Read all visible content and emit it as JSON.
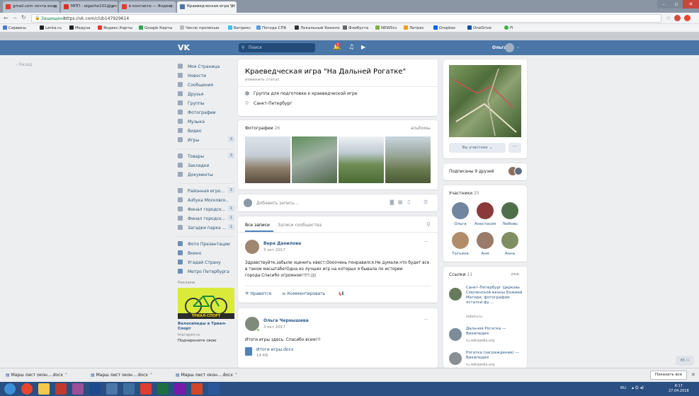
{
  "browser": {
    "tabs": [
      {
        "label": "gmail.com почта вход"
      },
      {
        "label": "МПП - olgache101@gm"
      },
      {
        "label": "в контакте — Яндекс:"
      },
      {
        "label": "Краеведческая игра \"Н"
      }
    ],
    "secure_label": "Защищено",
    "url": "https://vk.com/club147929614",
    "bookmarks": [
      "Сервисы",
      "Lenta.ru",
      "Медуза",
      "Яндекс.Карты",
      "Google Карты",
      "Число прописью",
      "Битрикс",
      "Погода СПб",
      "Локальный Кинопо",
      "Флибуста",
      "NEWSru",
      "Литрес",
      "Dropbox",
      "OneDrive",
      "Fi"
    ]
  },
  "vk": {
    "logo": "VK",
    "search_placeholder": "Поиск",
    "user_name": "Ольга",
    "back_label": "Назад"
  },
  "menu": {
    "items": [
      {
        "label": "Моя Страница",
        "count": ""
      },
      {
        "label": "Новости",
        "count": ""
      },
      {
        "label": "Сообщения",
        "count": ""
      },
      {
        "label": "Друзья",
        "count": ""
      },
      {
        "label": "Группы",
        "count": ""
      },
      {
        "label": "Фотографии",
        "count": ""
      },
      {
        "label": "Музыка",
        "count": ""
      },
      {
        "label": "Видео",
        "count": ""
      },
      {
        "label": "Игры",
        "count": "3"
      }
    ],
    "items2": [
      {
        "label": "Товары",
        "count": "3"
      },
      {
        "label": "Закладки",
        "count": ""
      },
      {
        "label": "Документы",
        "count": ""
      }
    ],
    "groups": [
      {
        "label": "Районная игро...",
        "count": "1"
      },
      {
        "label": "Азбука Московск..",
        "count": ""
      },
      {
        "label": "Финал городск...",
        "count": "1"
      },
      {
        "label": "Финал городск...",
        "count": "1"
      },
      {
        "label": "Загадки парка ...",
        "count": "1"
      }
    ],
    "apps": [
      {
        "label": "Фото Презентации"
      },
      {
        "label": "Вкино"
      },
      {
        "label": "Угадай Страну"
      },
      {
        "label": "Метро Петербурга"
      }
    ],
    "ad_title": "Реклама",
    "ad_brand": "ТРИАЛ-СПОРТ",
    "ad_name": "Велосипеды в Триал-Спорт",
    "ad_site": "trial-sport.ru",
    "ad_cta": "Подчеркните свою"
  },
  "group": {
    "title": "Краеведческая игра \"На Дальней Рогатке\"",
    "status_hint": "изменить статус",
    "description": "Группа для подготовки к краеведческой игре",
    "city": "Санкт-Петербург"
  },
  "photos": {
    "label": "Фотографии",
    "count": "26",
    "albums_link": "альбомы"
  },
  "composer": {
    "placeholder": "Добавить запись..."
  },
  "wall": {
    "tab_all": "Все записи",
    "tab_community": "Записи сообщества",
    "posts": [
      {
        "author": "Вера Данилова",
        "date": "3 окт 2017",
        "text": "Здравствуйте,забыли оценить квест:Оооочень понравился.Не думали,что будет все в таком масштабе!Одна из лучших игр на которых я бывала по истории города.Спасибо огромное!!!!!:)))",
        "like": "Нравится",
        "comment": "Комментировать"
      },
      {
        "author": "Ольга Чернышева",
        "date": "3 окт 2017",
        "text": "Итоги игры здесь. Спасибо всем!!!",
        "file_name": "Итоги игры.docx",
        "file_size": "14 КБ"
      }
    ]
  },
  "right": {
    "member_button": "Вы участник",
    "friends_subscribed": "Подписаны 9 друзей",
    "members_label": "Участники",
    "members_count": "25",
    "members": [
      "Ольга",
      "Анастасия",
      "Любовь",
      "Татьяна",
      "Аня",
      "Анна"
    ],
    "links_label": "Ссылки",
    "links_count": "11",
    "links_edit": "ред.",
    "links": [
      {
        "title": "Санкт-Петербург Церковь Смоленской иконы Божией Матери. фотография. остатки фу ...",
        "domain": "sobory.ru"
      },
      {
        "title": "Дальняя Рогатка — Википедия",
        "domain": "ru.wikipedia.org"
      },
      {
        "title": "Рогатка (заграждение) — Википедия",
        "domain": "ru.wikipedia.org"
      }
    ]
  },
  "downloads": {
    "items": [
      "Марш лист окон....docx",
      "Марш лист окон....docx",
      "Марш лист окон....docx"
    ],
    "show_all": "Показать все"
  },
  "taskbar": {
    "lang": "RU",
    "time": "8:17",
    "date": "27.04.2018"
  },
  "colors": {
    "vk_blue": "#4a76a8",
    "link": "#2a5885",
    "page_bg": "#edeef0"
  }
}
